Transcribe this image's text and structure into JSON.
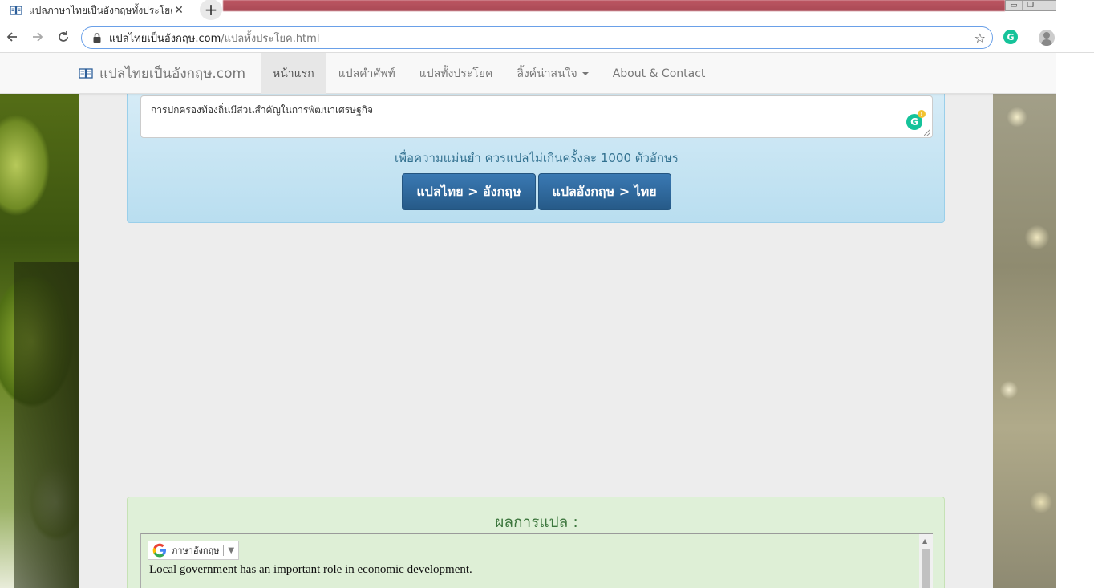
{
  "browser": {
    "tab_title": "แปลภาษาไทยเป็นอังกฤษทั้งประโยค",
    "url_host": "แปลไทยเป็นอังกฤษ.com",
    "url_path": "/แปลทั้งประโยค.html",
    "extension_letter": "G"
  },
  "navbar": {
    "brand": "แปลไทยเป็นอังกฤษ.com",
    "items": [
      {
        "label": "หน้าแรก",
        "active": true
      },
      {
        "label": "แปลคำศัพท์"
      },
      {
        "label": "แปลทั้งประโยค"
      },
      {
        "label": "ลิ้งค์น่าสนใจ"
      },
      {
        "label": "About & Contact"
      }
    ]
  },
  "translator": {
    "input_text": "การปกครองท้องถิ่นมีส่วนสำคัญในการพัฒนาเศรษฐกิจ",
    "grammarly_letter": "G",
    "hint": "เพื่อความแม่นยำ ควรแปลไม่เกินครั้งละ 1000 ตัวอักษร",
    "btn_th_en": "แปลไทย > อังกฤษ",
    "btn_en_th": "แปลอังกฤษ > ไทย"
  },
  "result": {
    "title": "ผลการแปล :",
    "language": "ภาษาอังกฤษ",
    "text": "Local government has an important role in economic development."
  },
  "colors": {
    "accent": "#265a88",
    "info_panel": "#d9edf7",
    "success_panel": "#dff0d8",
    "success_text": "#3c763d"
  }
}
